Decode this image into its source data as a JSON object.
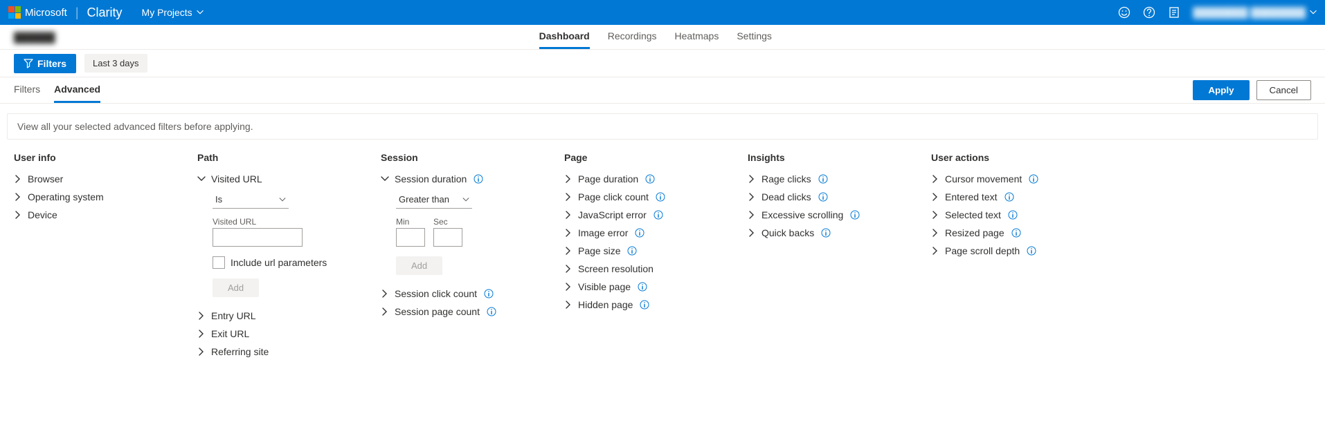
{
  "topbar": {
    "brand_ms": "Microsoft",
    "brand_product": "Clarity",
    "projects_dd": "My Projects",
    "user_name": "████████ ████████"
  },
  "subnav": {
    "project_name": "██████",
    "tabs": [
      {
        "label": "Dashboard",
        "active": true
      },
      {
        "label": "Recordings",
        "active": false
      },
      {
        "label": "Heatmaps",
        "active": false
      },
      {
        "label": "Settings",
        "active": false
      }
    ]
  },
  "filter_row": {
    "filters_btn": "Filters",
    "date_pill": "Last 3 days"
  },
  "filter_tabs": {
    "tabs": [
      {
        "label": "Filters",
        "active": false
      },
      {
        "label": "Advanced",
        "active": true
      }
    ],
    "apply": "Apply",
    "cancel": "Cancel"
  },
  "banner": "View all your selected advanced filters before applying.",
  "columns": {
    "user_info": {
      "title": "User info",
      "items": [
        "Browser",
        "Operating system",
        "Device"
      ]
    },
    "path": {
      "title": "Path",
      "visited_url": {
        "label": "Visited URL",
        "op": "Is",
        "field_label": "Visited URL",
        "include_params": "Include url parameters",
        "add": "Add"
      },
      "items": [
        "Entry URL",
        "Exit URL",
        "Referring site"
      ]
    },
    "session": {
      "title": "Session",
      "duration": {
        "label": "Session duration",
        "op": "Greater than",
        "min_label": "Min",
        "sec_label": "Sec",
        "add": "Add"
      },
      "items": [
        "Session click count",
        "Session page count"
      ]
    },
    "page": {
      "title": "Page",
      "items": [
        "Page duration",
        "Page click count",
        "JavaScript error",
        "Image error",
        "Page size",
        "Screen resolution",
        "Visible page",
        "Hidden page"
      ],
      "info": [
        true,
        true,
        true,
        true,
        true,
        false,
        true,
        true
      ]
    },
    "insights": {
      "title": "Insights",
      "items": [
        "Rage clicks",
        "Dead clicks",
        "Excessive scrolling",
        "Quick backs"
      ]
    },
    "user_actions": {
      "title": "User actions",
      "items": [
        "Cursor movement",
        "Entered text",
        "Selected text",
        "Resized page",
        "Page scroll depth"
      ]
    }
  }
}
